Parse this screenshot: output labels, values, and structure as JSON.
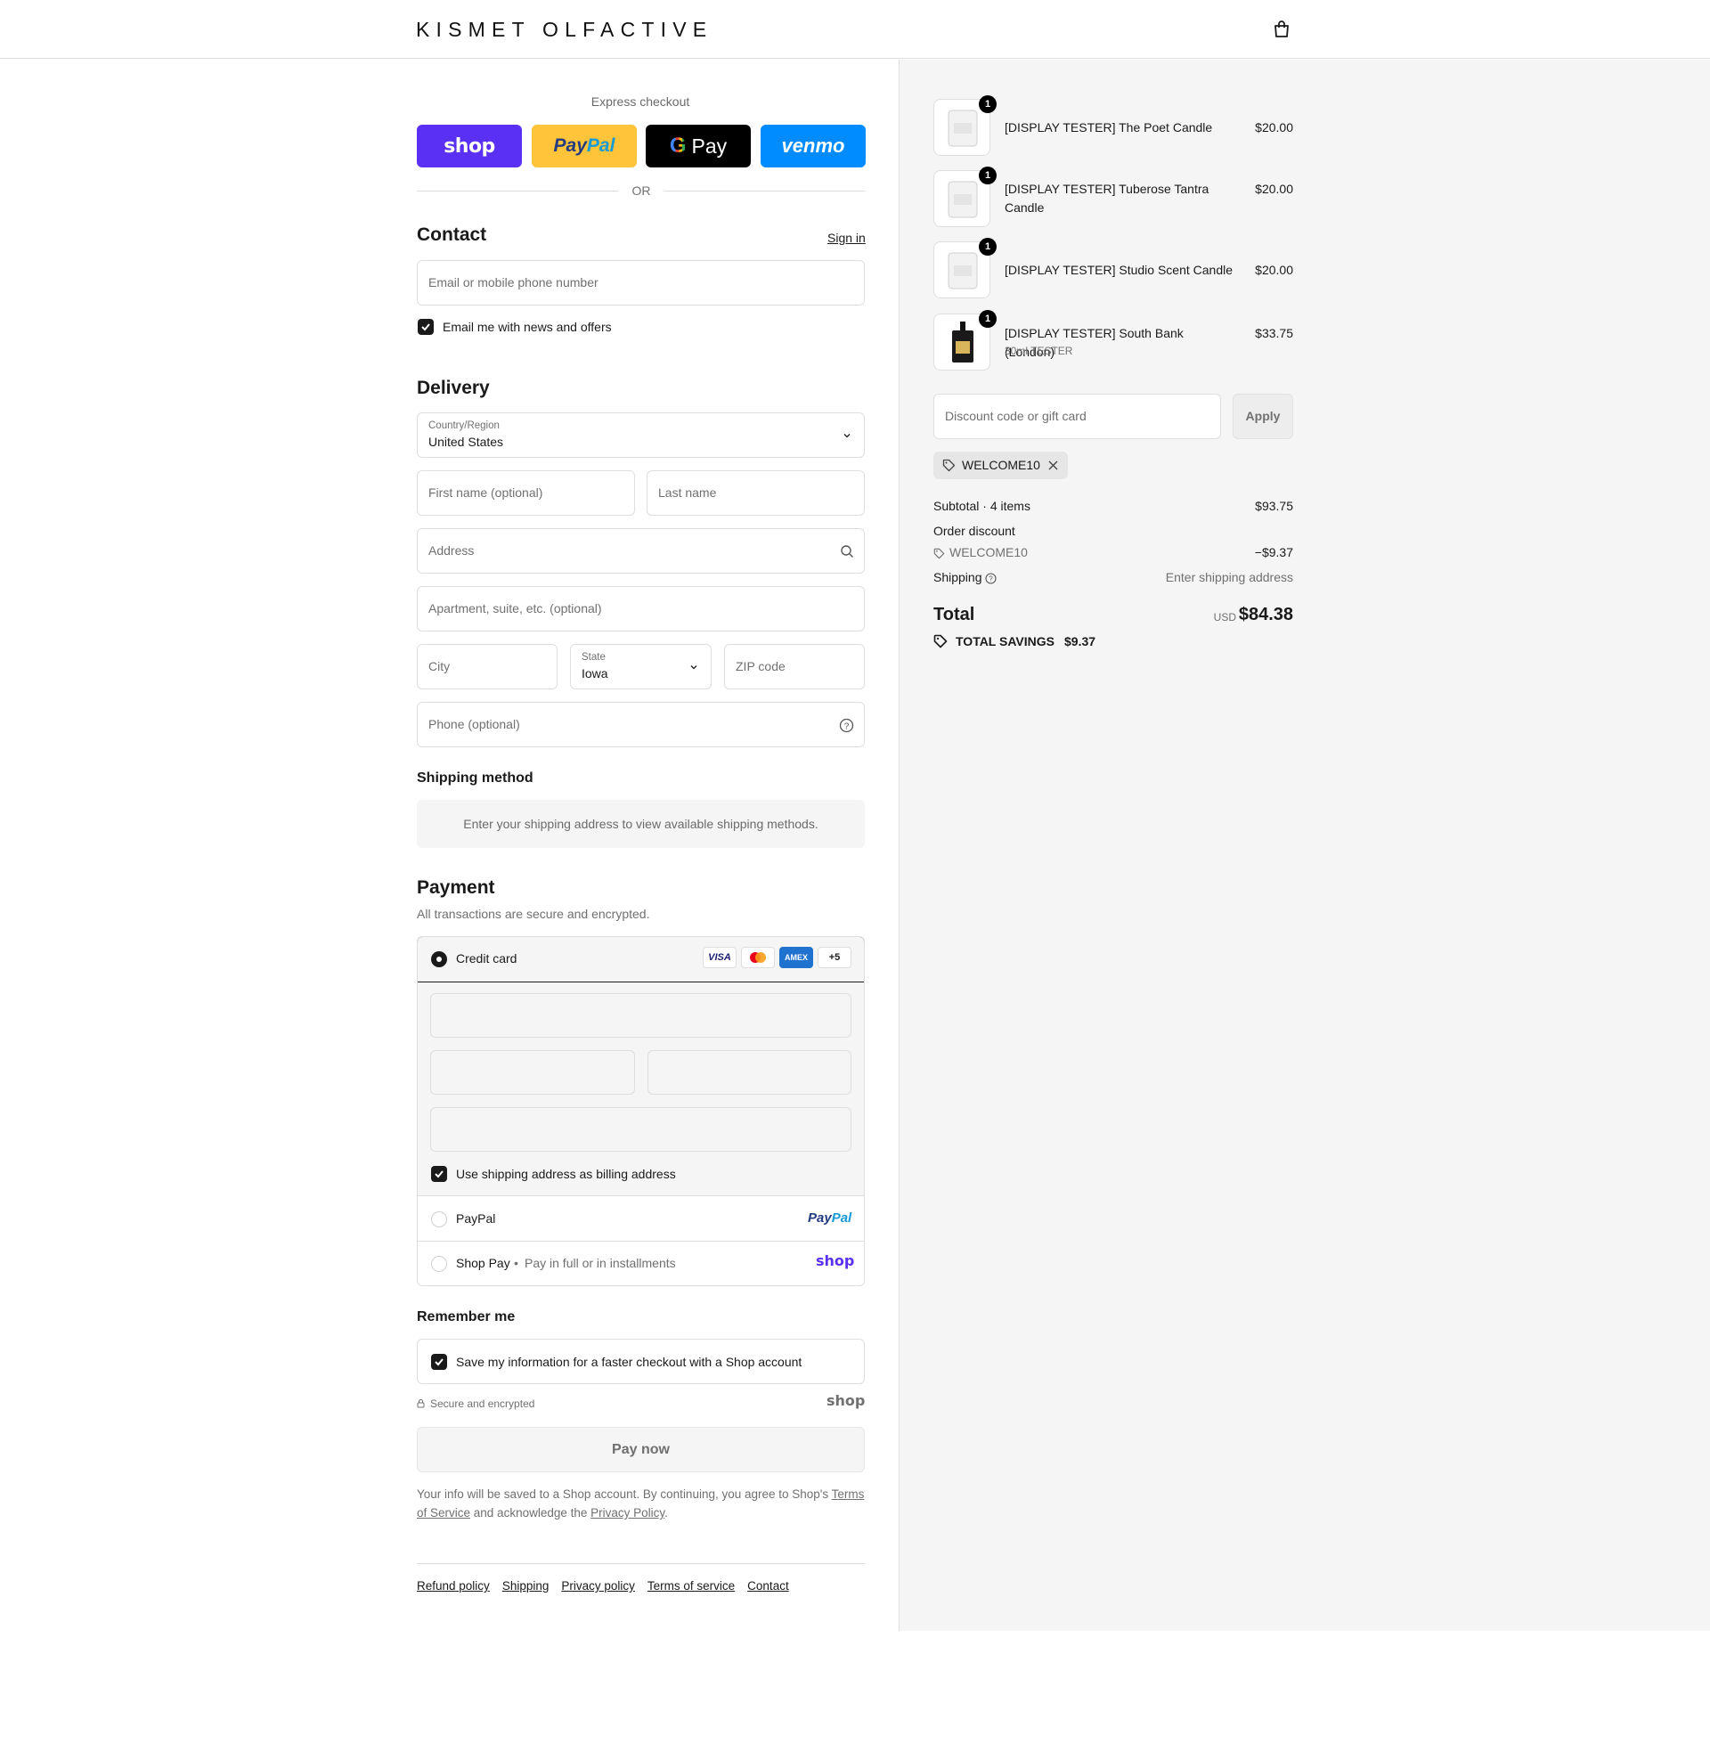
{
  "header": {
    "brand": "KISMET OLFACTIVE",
    "cart_icon": "shopping-bag-icon"
  },
  "express": {
    "title": "Express checkout",
    "buttons": [
      "shop",
      "PayPal",
      "G Pay",
      "venmo"
    ],
    "or": "OR"
  },
  "contact": {
    "heading": "Contact",
    "sign_in": "Sign in",
    "email_placeholder": "Email or mobile phone number",
    "news_label": "Email me with news and offers"
  },
  "delivery": {
    "heading": "Delivery",
    "country_label": "Country/Region",
    "country_value": "United States",
    "first_name": "First name (optional)",
    "last_name": "Last name",
    "address": "Address",
    "apartment": "Apartment, suite, etc. (optional)",
    "city": "City",
    "state_label": "State",
    "state_value": "Iowa",
    "zip": "ZIP code",
    "phone": "Phone (optional)"
  },
  "shipping": {
    "heading": "Shipping method",
    "info": "Enter your shipping address to view available shipping methods."
  },
  "payment": {
    "heading": "Payment",
    "subtitle": "All transactions are secure and encrypted.",
    "credit_card": "Credit card",
    "card_brands": [
      "VISA",
      "MC",
      "AMEX"
    ],
    "more_cards": "+5",
    "billing_same": "Use shipping address as billing address",
    "paypal": "PayPal",
    "paypal_logo": "PayPal",
    "shop_pay": "Shop Pay",
    "shop_pay_note": "Pay in full or in installments",
    "shop_logo": "shop"
  },
  "remember": {
    "heading": "Remember me",
    "save_label": "Save my information for a faster checkout with a Shop account",
    "secure": "Secure and encrypted",
    "shop_logo": "shop"
  },
  "pay_now": "Pay now",
  "disclaimer": {
    "text1": "Your info will be saved to a Shop account. By continuing, you agree to Shop's ",
    "tos": "Terms of Service",
    "text2": " and acknowledge the ",
    "privacy": "Privacy Policy",
    "text3": "."
  },
  "footer": [
    "Refund policy",
    "Shipping",
    "Privacy policy",
    "Terms of service",
    "Contact"
  ],
  "summary": {
    "items": [
      {
        "qty": "1",
        "name": "[DISPLAY TESTER] The Poet Candle",
        "sub": "",
        "price": "$20.00"
      },
      {
        "qty": "1",
        "name": "[DISPLAY TESTER] Tuberose Tantra Candle",
        "sub": "",
        "price": "$20.00"
      },
      {
        "qty": "1",
        "name": "[DISPLAY TESTER] Studio Scent Candle",
        "sub": "",
        "price": "$20.00"
      },
      {
        "qty": "1",
        "name": "[DISPLAY TESTER] South Bank (London)",
        "sub": "30ml TESTER",
        "price": "$33.75"
      }
    ],
    "discount_placeholder": "Discount code or gift card",
    "apply": "Apply",
    "code": "WELCOME10",
    "subtotal_label": "Subtotal · 4 items",
    "subtotal": "$93.75",
    "order_discount": "Order discount",
    "discount_code": "WELCOME10",
    "discount_amount": "−$9.37",
    "shipping_label": "Shipping",
    "shipping_value": "Enter shipping address",
    "total_label": "Total",
    "currency": "USD",
    "total": "$84.38",
    "savings_label": "TOTAL SAVINGS",
    "savings": "$9.37"
  }
}
